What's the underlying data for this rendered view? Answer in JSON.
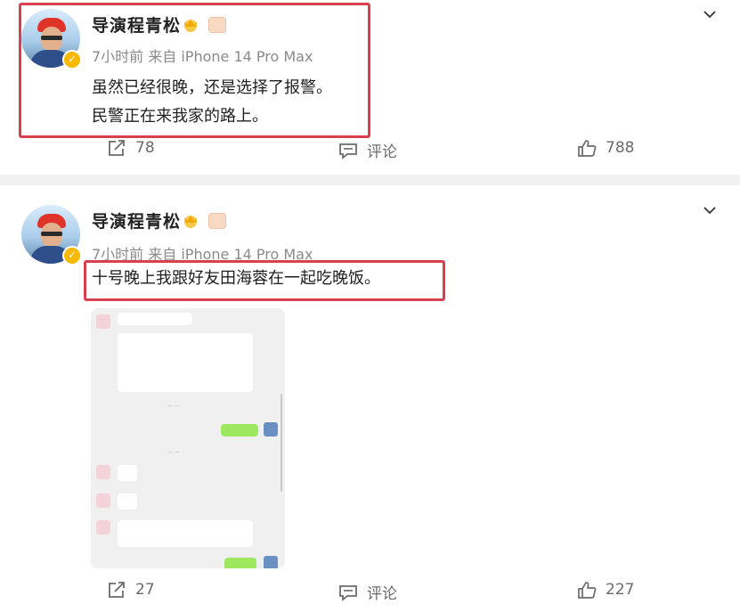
{
  "posts": [
    {
      "username": "导演程青松",
      "meta": "7小时前  来自 iPhone 14 Pro Max",
      "lines": [
        "虽然已经很晚，还是选择了报警。",
        "民警正在来我家的路上。"
      ],
      "actions": {
        "repost": "78",
        "comment": "评论",
        "like": "788"
      }
    },
    {
      "username": "导演程青松",
      "meta": "7小时前  来自 iPhone 14 Pro Max",
      "lines": [
        "十号晚上我跟好友田海蓉在一起吃晚饭。"
      ],
      "actions": {
        "repost": "27",
        "comment": "评论",
        "like": "227"
      }
    }
  ],
  "icons": [
    "chevron-down-icon",
    "repost-icon",
    "comment-icon",
    "like-icon",
    "verified-badge-icon",
    "crown-badge-icon"
  ],
  "colors": {
    "highlight": "#d84050",
    "verified": "#f6b900",
    "chat_green": "#9ee85f"
  }
}
